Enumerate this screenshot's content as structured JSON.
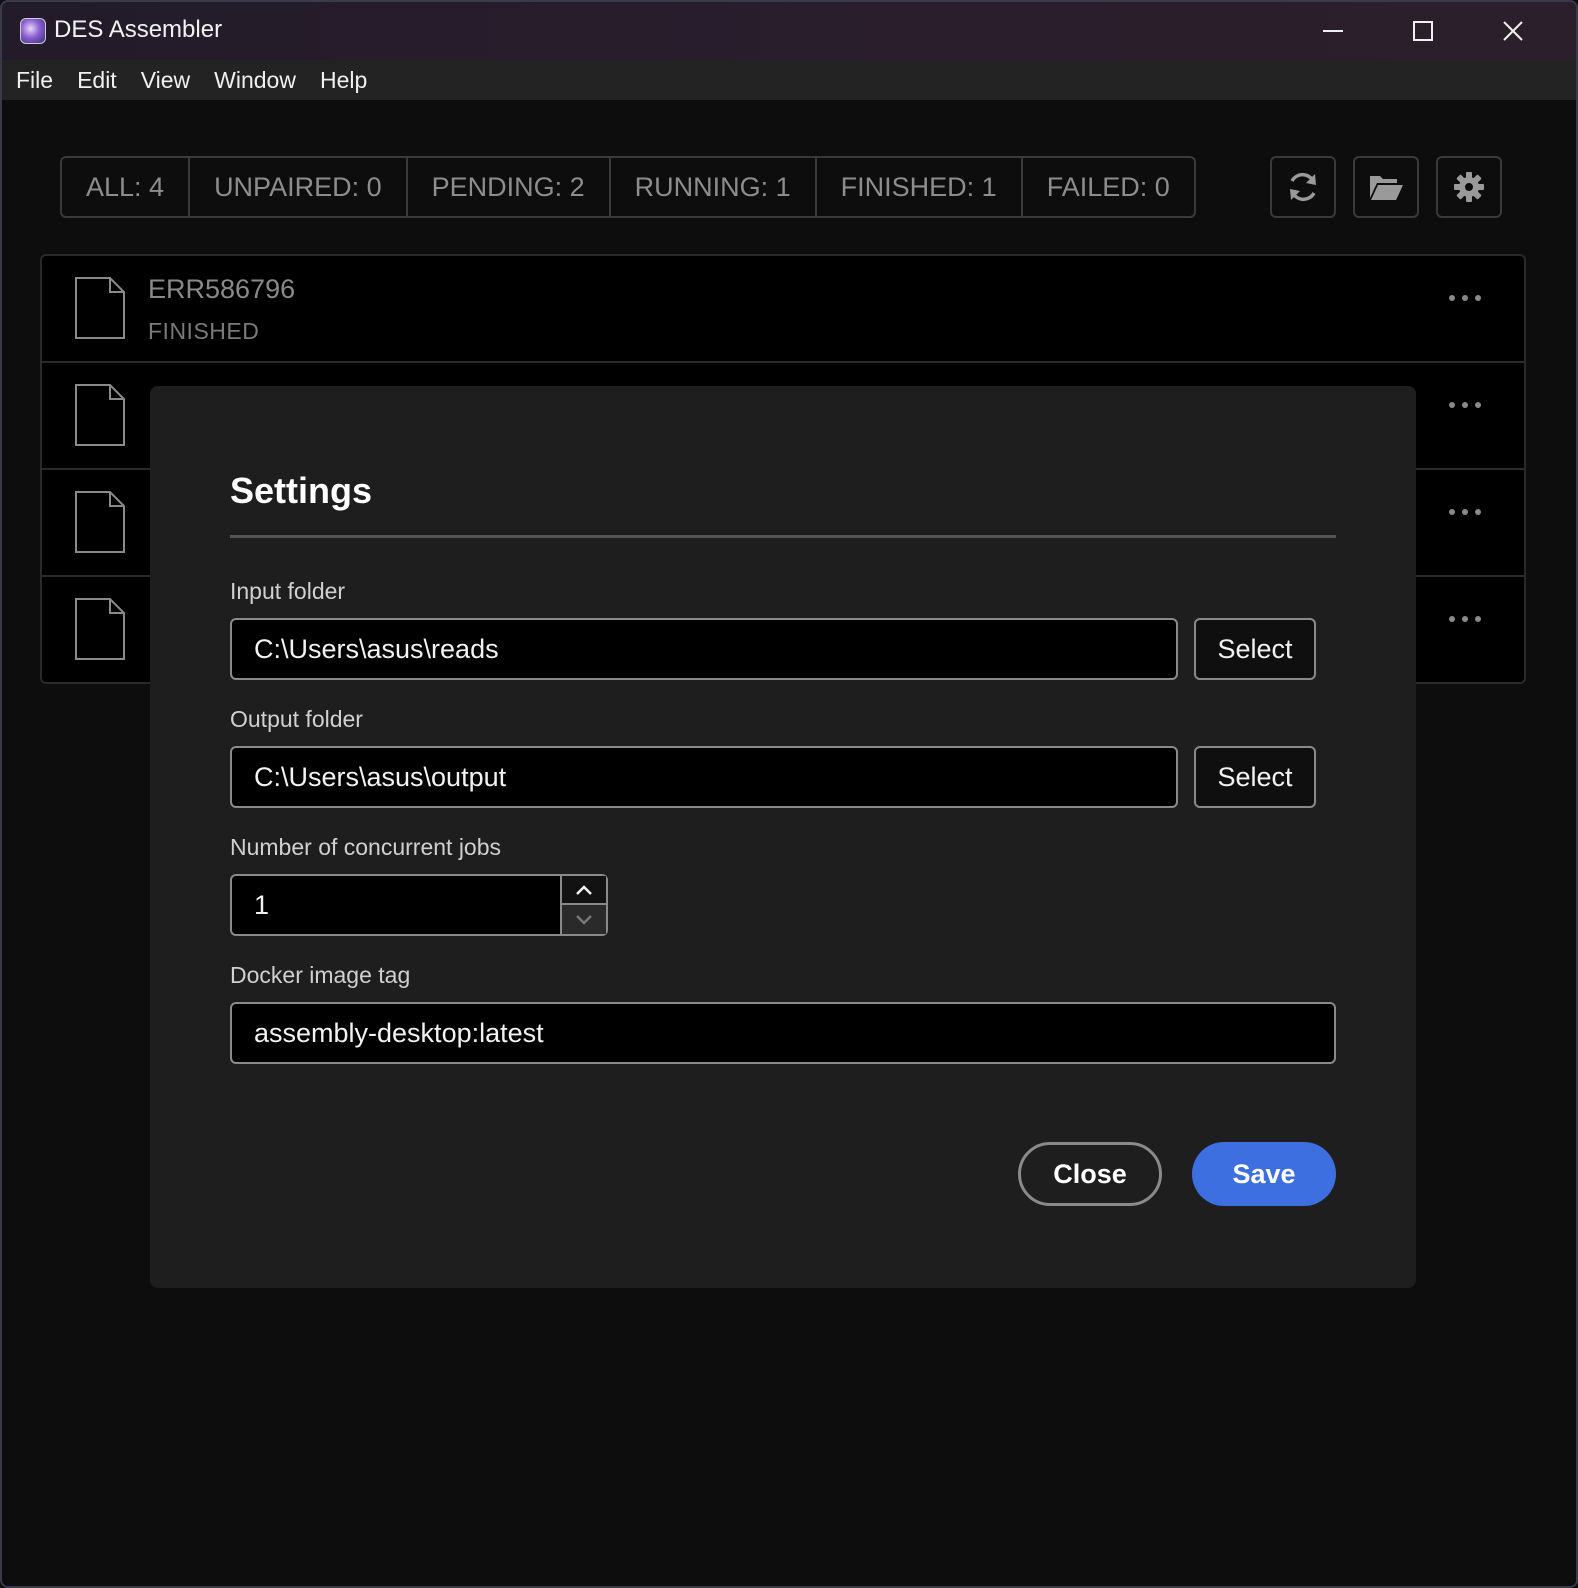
{
  "window": {
    "title": "DES Assembler",
    "minimize_icon": "minimize-icon",
    "maximize_icon": "maximize-icon",
    "close_icon": "close-icon"
  },
  "menu": [
    "File",
    "Edit",
    "View",
    "Window",
    "Help"
  ],
  "filters": [
    {
      "label": "ALL: 4"
    },
    {
      "label": "UNPAIRED: 0"
    },
    {
      "label": "PENDING: 2"
    },
    {
      "label": "RUNNING: 1"
    },
    {
      "label": "FINISHED: 1"
    },
    {
      "label": "FAILED: 0"
    }
  ],
  "toolbar": {
    "icons": [
      "refresh-icon",
      "folder-open-icon",
      "gear-icon"
    ]
  },
  "jobs": [
    {
      "name": "ERR586796",
      "status": "FINISHED"
    },
    {
      "name": "",
      "status": ""
    },
    {
      "name": "",
      "status": ""
    },
    {
      "name": "",
      "status": ""
    }
  ],
  "settings": {
    "title": "Settings",
    "input_folder_label": "Input folder",
    "input_folder_value": "C:\\Users\\asus\\reads",
    "output_folder_label": "Output folder",
    "output_folder_value": "C:\\Users\\asus\\output",
    "select_label": "Select",
    "concurrent_label": "Number of concurrent jobs",
    "concurrent_value": "1",
    "docker_label": "Docker image tag",
    "docker_value": "assembly-desktop:latest",
    "close_label": "Close",
    "save_label": "Save"
  },
  "colors": {
    "accent": "#3d6fe0",
    "dialog_bg": "#1e1e1e",
    "app_bg": "#0d0d0d"
  }
}
